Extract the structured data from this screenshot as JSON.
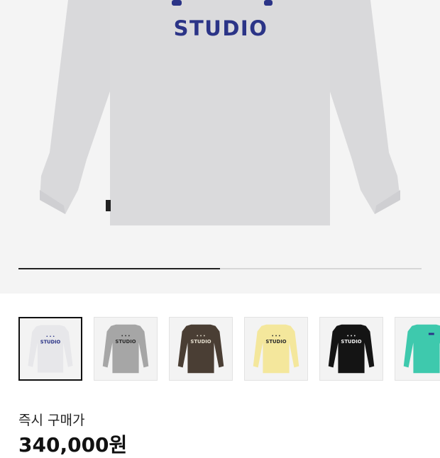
{
  "hero": {
    "brand_text": "STUDIO",
    "brand_color": "#2b3487",
    "shirt_color": "#d9d9db",
    "slider": {
      "current_index": 1,
      "total": 2
    }
  },
  "thumbnails": [
    {
      "shirt_color": "#e7e7ea",
      "print_color": "#2b3487",
      "print_text": "STUDIO",
      "selected": true
    },
    {
      "shirt_color": "#a6a6a6",
      "print_color": "#2a2a2a",
      "print_text": "STUDIO",
      "selected": false
    },
    {
      "shirt_color": "#4a3e34",
      "print_color": "#e6dfcf",
      "print_text": "STUDIO",
      "selected": false
    },
    {
      "shirt_color": "#f4e79c",
      "print_color": "#2a2a2a",
      "print_text": "STUDIO",
      "selected": false
    },
    {
      "shirt_color": "#141414",
      "print_color": "#f2f2f2",
      "print_text": "STUDIO",
      "selected": false
    },
    {
      "shirt_color": "#3ec9ad",
      "print_color": "#2b3487",
      "print_text": "",
      "selected": false
    }
  ],
  "price": {
    "label": "즉시 구매가",
    "value": "340,000원"
  }
}
